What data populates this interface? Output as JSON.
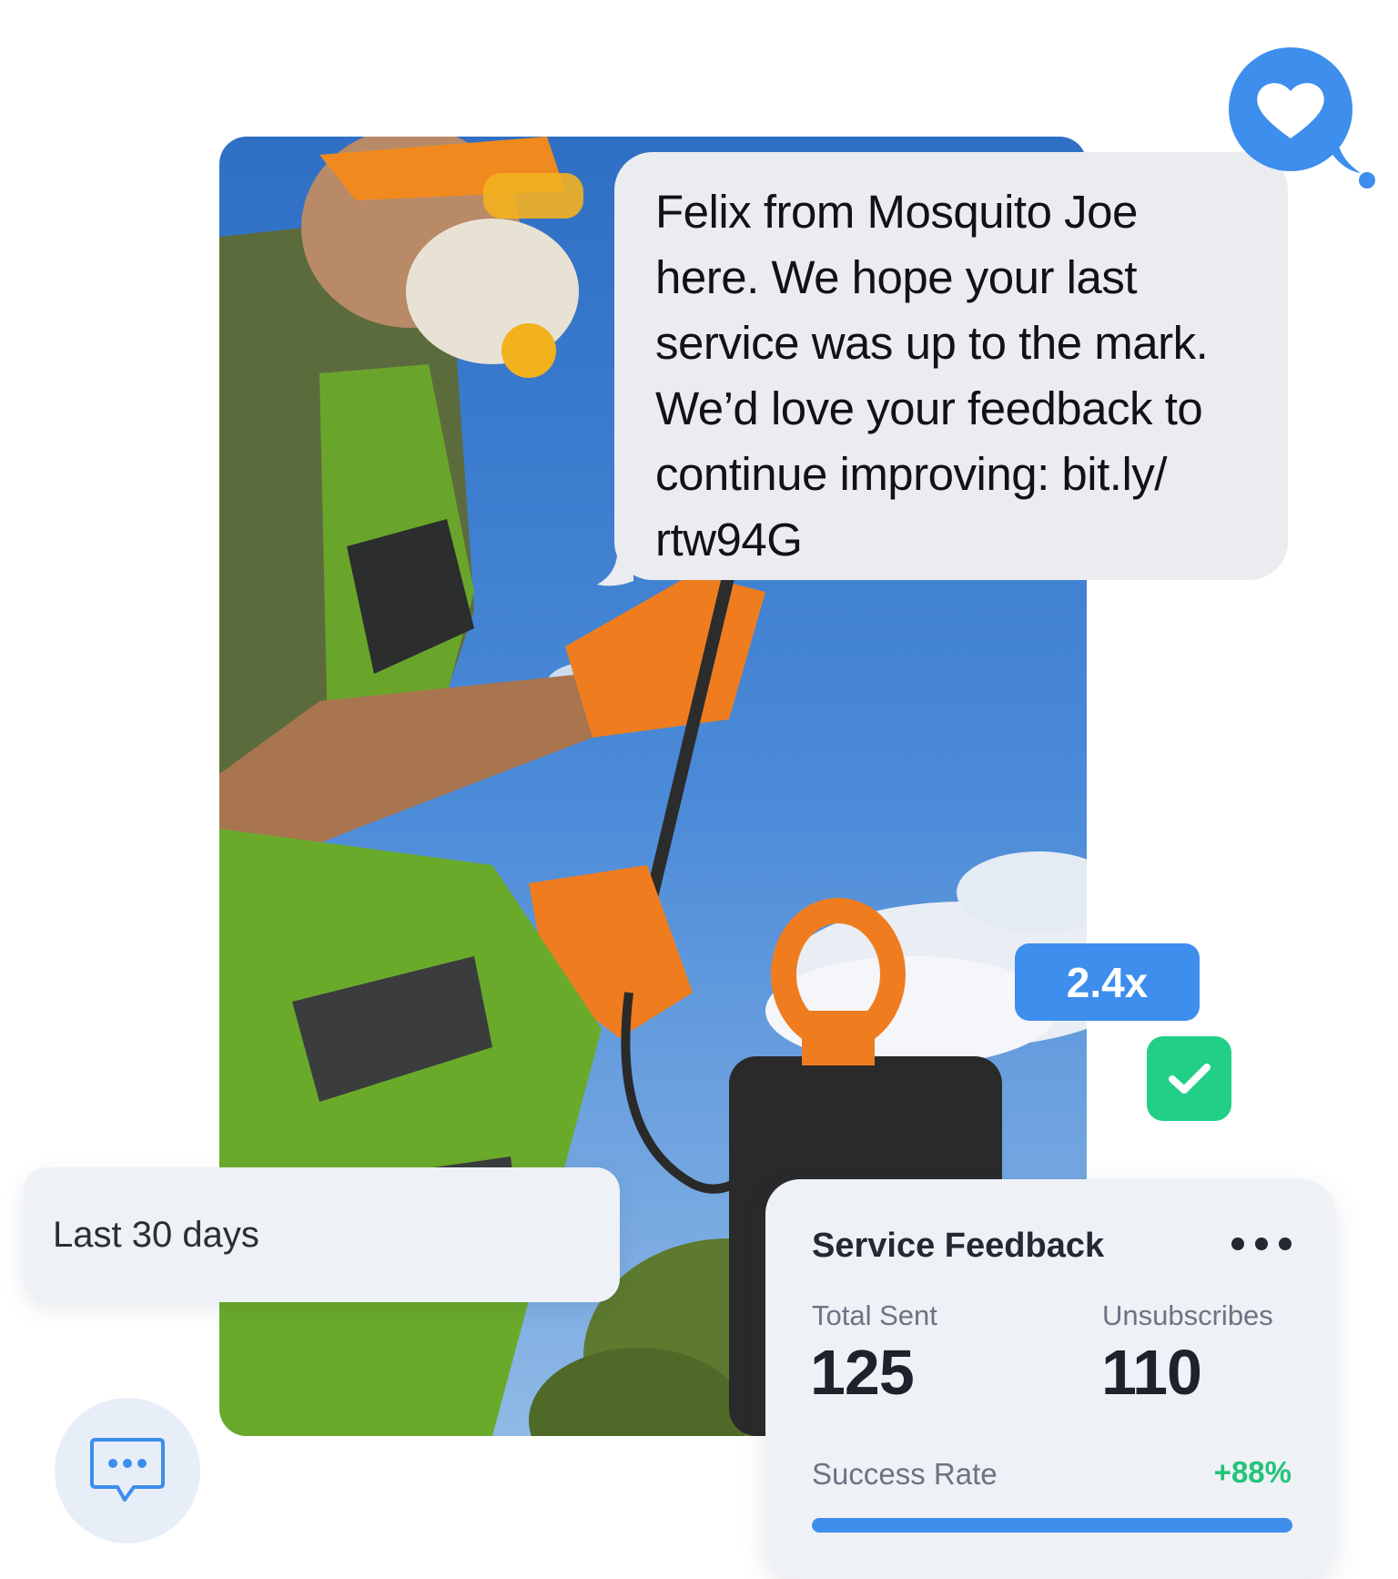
{
  "message": {
    "lines": [
      "Felix from Mosquito Joe",
      "here. We hope your last",
      "service was up to the mark.",
      "We’d love your feedback to",
      "continue improving: bit.ly/",
      "rtw94G"
    ]
  },
  "badges": {
    "multiplier": "2.4x",
    "heart_icon": "heart-icon",
    "check_icon": "checkmark-icon"
  },
  "range": {
    "label": "Last 30 days"
  },
  "card": {
    "title": "Service Feedback",
    "total_sent_label": "Total Sent",
    "total_sent_value": "125",
    "unsubscribes_label": "Unsubscribes",
    "unsubscribes_value": "110",
    "success_rate_label": "Success Rate",
    "success_rate_value": "+88%",
    "success_rate_fraction": 1.0
  },
  "colors": {
    "accent_blue": "#3d8eed",
    "success_green": "#22cf86",
    "bubble_gray": "#ebecf0",
    "card_bg": "#eef1f5"
  }
}
